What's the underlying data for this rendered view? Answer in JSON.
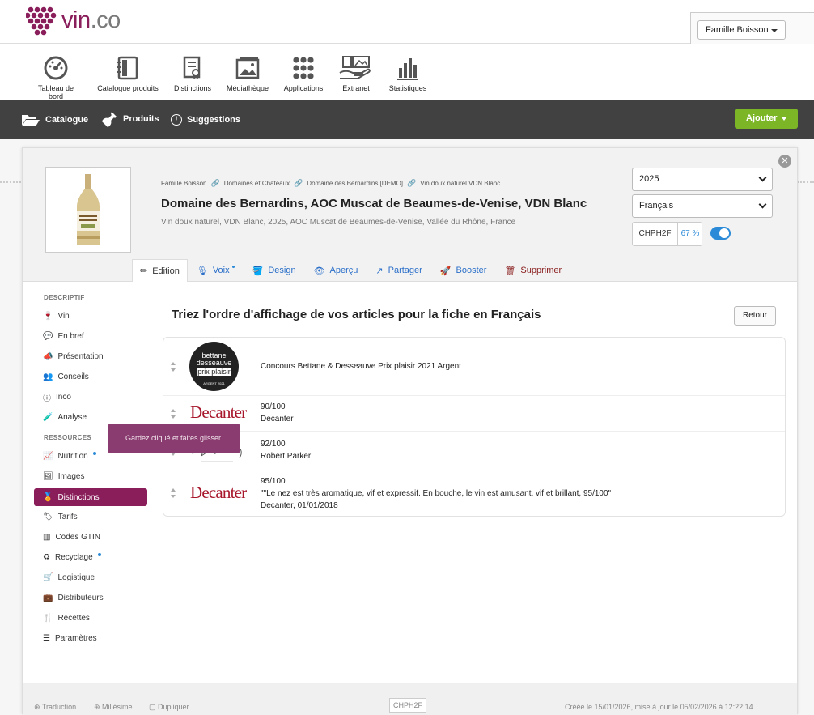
{
  "header": {
    "logo_text": "vin",
    "logo_tld": ".co",
    "company": "Famille Boisson"
  },
  "iconbar": {
    "items": [
      "Tableau de bord",
      "Catalogue produits",
      "Distinctions",
      "Médiathèque",
      "Applications",
      "Extranet",
      "Statistiques"
    ]
  },
  "mainnav": {
    "items": [
      "Catalogue",
      "Produits",
      "Suggestions"
    ],
    "add_label": "Ajouter"
  },
  "product": {
    "breadcrumb": [
      "Famille Boisson",
      "Domaines et Châteaux",
      "Domaine des Bernardins [DEMO]",
      "Vin doux naturel VDN Blanc"
    ],
    "title": "Domaine des Bernardins, AOC Muscat de Beaumes-de-Venise, VDN Blanc",
    "subtitle": "Vin doux naturel, VDN Blanc, 2025, AOC Muscat de Beaumes-de-Venise, Vallée du Rhône, France",
    "vintage": "2025",
    "language": "Français",
    "code": "CHPH2F",
    "completion": "67 %"
  },
  "tabs": {
    "edition": "Edition",
    "voix": "Voix",
    "design": "Design",
    "apercu": "Aperçu",
    "partager": "Partager",
    "booster": "Booster",
    "supprimer": "Supprimer"
  },
  "leftnav": {
    "descriptif_title": "DESCRIPTIF",
    "descriptif": [
      "Vin",
      "En bref",
      "Présentation",
      "Conseils",
      "Inco",
      "Analyse"
    ],
    "ressources_title": "RESSOURCES",
    "ressources": [
      "Nutrition",
      "Images",
      "Distinctions",
      "Tarifs",
      "Codes GTIN",
      "Recyclage",
      "Logistique",
      "Distributeurs",
      "Recettes",
      "Paramètres"
    ]
  },
  "content": {
    "title": "Triez l'ordre d'affichage de vos articles pour la fiche en Français",
    "back_label": "Retour",
    "tooltip": "Gardez cliqué et faites glisser.",
    "rows": [
      {
        "line1": "Concours Bettane & Desseauve Prix plaisir 2021 Argent",
        "line2": "",
        "line3": "",
        "logo": "bettane-desseauve-medal"
      },
      {
        "line1": "90/100",
        "line2": "Decanter",
        "line3": "",
        "logo": "decanter-logo"
      },
      {
        "line1": "92/100",
        "line2": "Robert Parker",
        "line3": "",
        "logo": "robert-parker-logo"
      },
      {
        "line1": "95/100",
        "line2": "\"\"Le nez est très aromatique, vif et expressif. En bouche, le vin est amusant, vif et brillant, 95/100\"",
        "line3": "Decanter, 01/01/2018",
        "logo": "decanter-logo"
      }
    ],
    "medal": {
      "l1": "bettane",
      "l2": "desseauve",
      "l3": "prix plaisir",
      "l4": "ARGENT 2021"
    },
    "decanter_text": "Decanter"
  },
  "footer": {
    "translation": "Traduction",
    "millesime": "Millésime",
    "dupliquer": "Dupliquer",
    "code": "CHPH2F",
    "dates": "Créée le 15/01/2026, mise à jour le 05/02/2026 à 12:22:14"
  },
  "colors": {
    "brand": "#8a1e5b",
    "accent": "#2a8ad8",
    "add": "#7cb526",
    "dark": "#414141"
  }
}
